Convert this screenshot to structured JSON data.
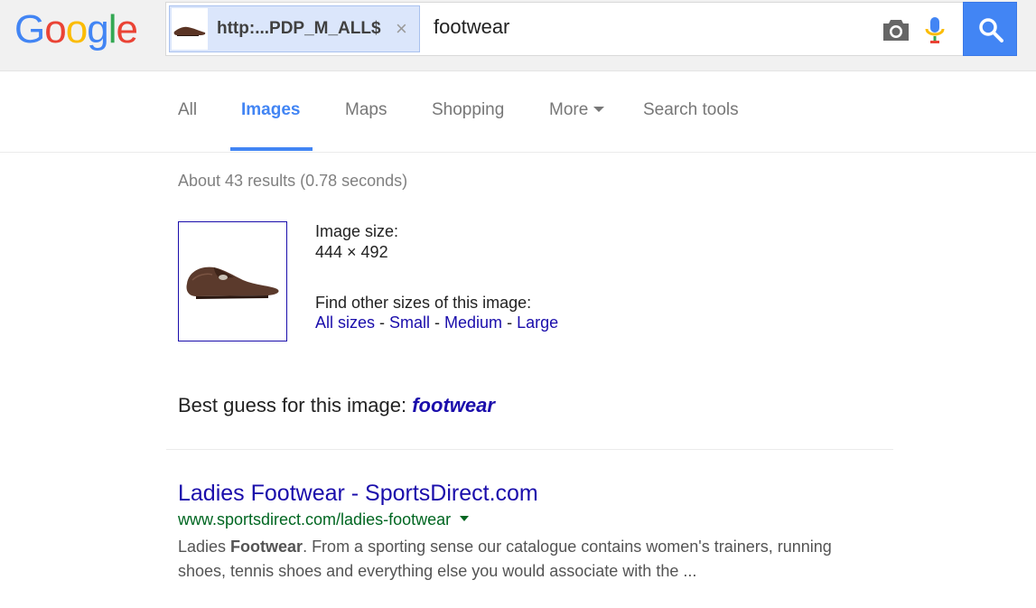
{
  "logo": {
    "text": "Google",
    "colors": [
      "#4285f4",
      "#ea4335",
      "#fbbc05",
      "#4285f4",
      "#34a853",
      "#ea4335"
    ]
  },
  "search": {
    "chip_label": "http:...PDP_M_ALL$",
    "chip_close": "×",
    "query": "footwear",
    "icons": [
      "camera-icon",
      "mic-icon",
      "search-icon"
    ],
    "accent": "#4285f4"
  },
  "tabs": [
    {
      "label": "All",
      "active": false
    },
    {
      "label": "Images",
      "active": true
    },
    {
      "label": "Maps",
      "active": false
    },
    {
      "label": "Shopping",
      "active": false
    },
    {
      "label": "More",
      "active": false
    },
    {
      "label": "Search tools",
      "active": false
    }
  ],
  "stats": "About 43 results (0.78 seconds)",
  "image_info": {
    "size_label": "Image size:",
    "size_value": "444 × 492",
    "other_sizes_label": "Find other sizes of this image:",
    "links": [
      "All sizes",
      "Small",
      "Medium",
      "Large"
    ],
    "separator": " - "
  },
  "best_guess": {
    "prefix": "Best guess for this image: ",
    "term": "footwear"
  },
  "results": [
    {
      "title": "Ladies Footwear - SportsDirect.com",
      "url": "www.sportsdirect.com/ladies-footwear",
      "snippet_pre": "Ladies ",
      "snippet_bold": "Footwear",
      "snippet_post": ". From a sporting sense our catalogue contains women's trainers, running shoes, tennis shoes and everything else you would associate with the ..."
    }
  ]
}
